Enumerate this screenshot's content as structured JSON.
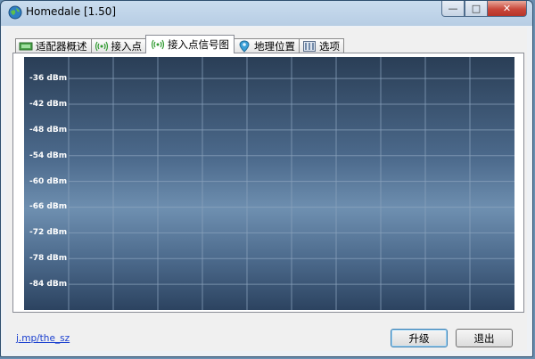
{
  "window": {
    "title": "Homedale [1.50]",
    "minimize_glyph": "—",
    "maximize_glyph": "□",
    "close_glyph": "✕"
  },
  "tabs": [
    {
      "label": "适配器概述",
      "icon": "adapter-icon",
      "active": false
    },
    {
      "label": "接入点",
      "icon": "wireless-icon",
      "active": false
    },
    {
      "label": "接入点信号图",
      "icon": "wireless-icon",
      "active": true
    },
    {
      "label": "地理位置",
      "icon": "map-pin-icon",
      "active": false
    },
    {
      "label": "选项",
      "icon": "options-icon",
      "active": false
    }
  ],
  "chart_data": {
    "type": "line",
    "y_ticks": [
      -36,
      -42,
      -48,
      -54,
      -60,
      -66,
      -72,
      -78,
      -84
    ],
    "y_tick_labels": [
      "-36 dBm",
      "-42 dBm",
      "-48 dBm",
      "-54 dBm",
      "-60 dBm",
      "-66 dBm",
      "-72 dBm",
      "-78 dBm",
      "-84 dBm"
    ],
    "ylim": [
      -31,
      -90
    ],
    "x_grid_count": 10,
    "grid": true,
    "series": []
  },
  "footer": {
    "link_text": "j.mp/the_sz",
    "upgrade_label": "升级",
    "exit_label": "退出"
  },
  "colors": {
    "grid": "#8aa2bc",
    "label": "#ffffff"
  }
}
